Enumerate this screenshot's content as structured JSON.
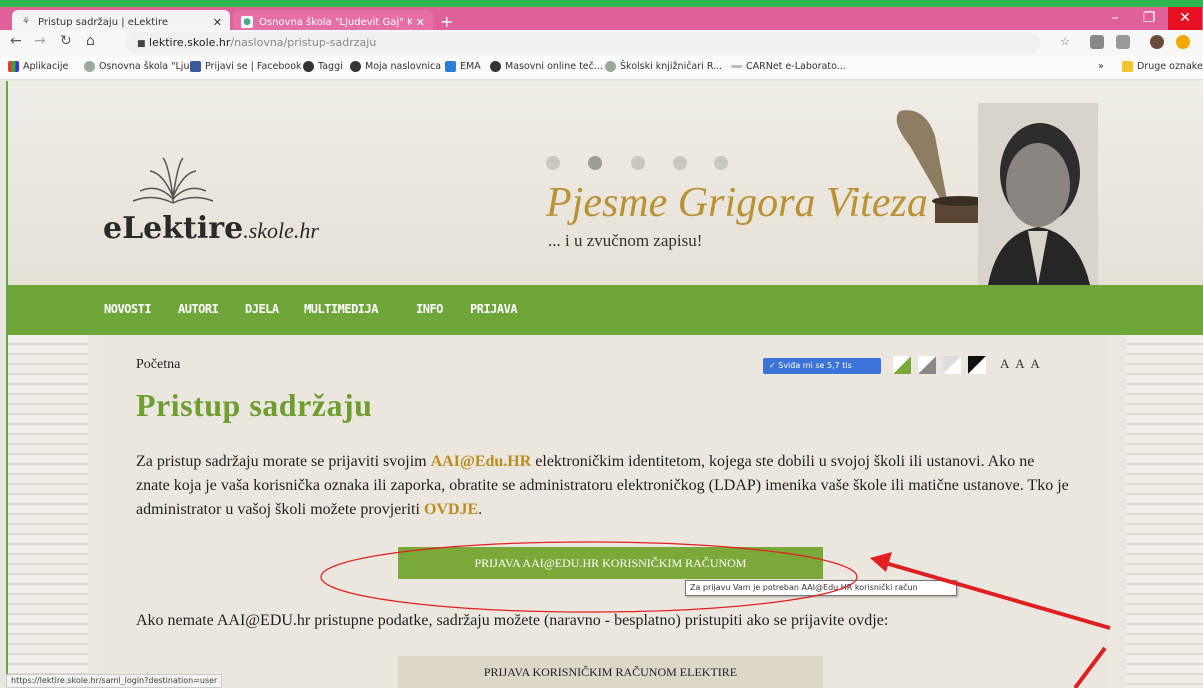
{
  "browser": {
    "tabs": [
      {
        "label": "Pristup sadržaju | eLektire",
        "active": true
      },
      {
        "label": "Osnovna škola \"Ljudevit Gaj\" Kr...",
        "active": false
      }
    ],
    "url_host": "lektire.skole.hr",
    "url_path": "/naslovna/pristup-sadrzaju",
    "bookmarks": [
      "Aplikacije",
      "Osnovna škola \"Lju...",
      "Prijavi se | Facebook",
      "Taggi",
      "Moja naslovnica",
      "EMA",
      "Masovni online teč...",
      "Školski knjižničari R...",
      "CARNet e-Laborato...",
      "»",
      "Druge oznake"
    ],
    "status_url": "https://lektire.skole.hr/saml_login?destination=user"
  },
  "site": {
    "logo_main": "eLektire",
    "logo_sub": ".skole.hr",
    "banner_title": "Pjesme Grigora Viteza",
    "banner_subtitle": "... i u zvučnom zapisu!",
    "nav": [
      "NOVOSTI",
      "AUTORI",
      "DJELA",
      "MULTIMEDIJA",
      "INFO",
      "PRIJAVA"
    ]
  },
  "content": {
    "breadcrumb": "Početna",
    "like_button": "✓ Sviđa mi se 5,7 tis",
    "font_controls": "A A A",
    "title": "Pristup sadržaju",
    "intro_before": "Za pristup sadržaju morate se prijaviti svojim ",
    "intro_aai": "AAI@Edu.HR",
    "intro_middle": " elektroničkim identitetom, kojega ste dobili u svojoj školi ili ustanovi. Ako ne znate koja je vaša korisnička oznaka ili zaporka, obratite se administratoru elektroničkog (LDAP) imenika vaše škole ili matične ustanove. Tko je administrator u vašoj školi možete provjeriti ",
    "intro_link": "OVDJE",
    "intro_after": ".",
    "primary_button": "PRIJAVA AAI@EDU.HR KORISNIČKIM RAČUNOM",
    "tooltip": "Za prijavu Vam je potreban AAI@Edu.HR korisnički račun",
    "para2": "Ako nemate AAI@EDU.hr pristupne podatke, sadržaju možete (naravno - besplatno) pristupiti ako se prijavite ovdje:",
    "secondary_button": "PRIJAVA KORISNIČKIM RAČUNOM ELEKTIRE"
  },
  "colors": {
    "accent_green": "#6ea63a",
    "gold": "#b99235",
    "annotation_red": "#e02020"
  }
}
